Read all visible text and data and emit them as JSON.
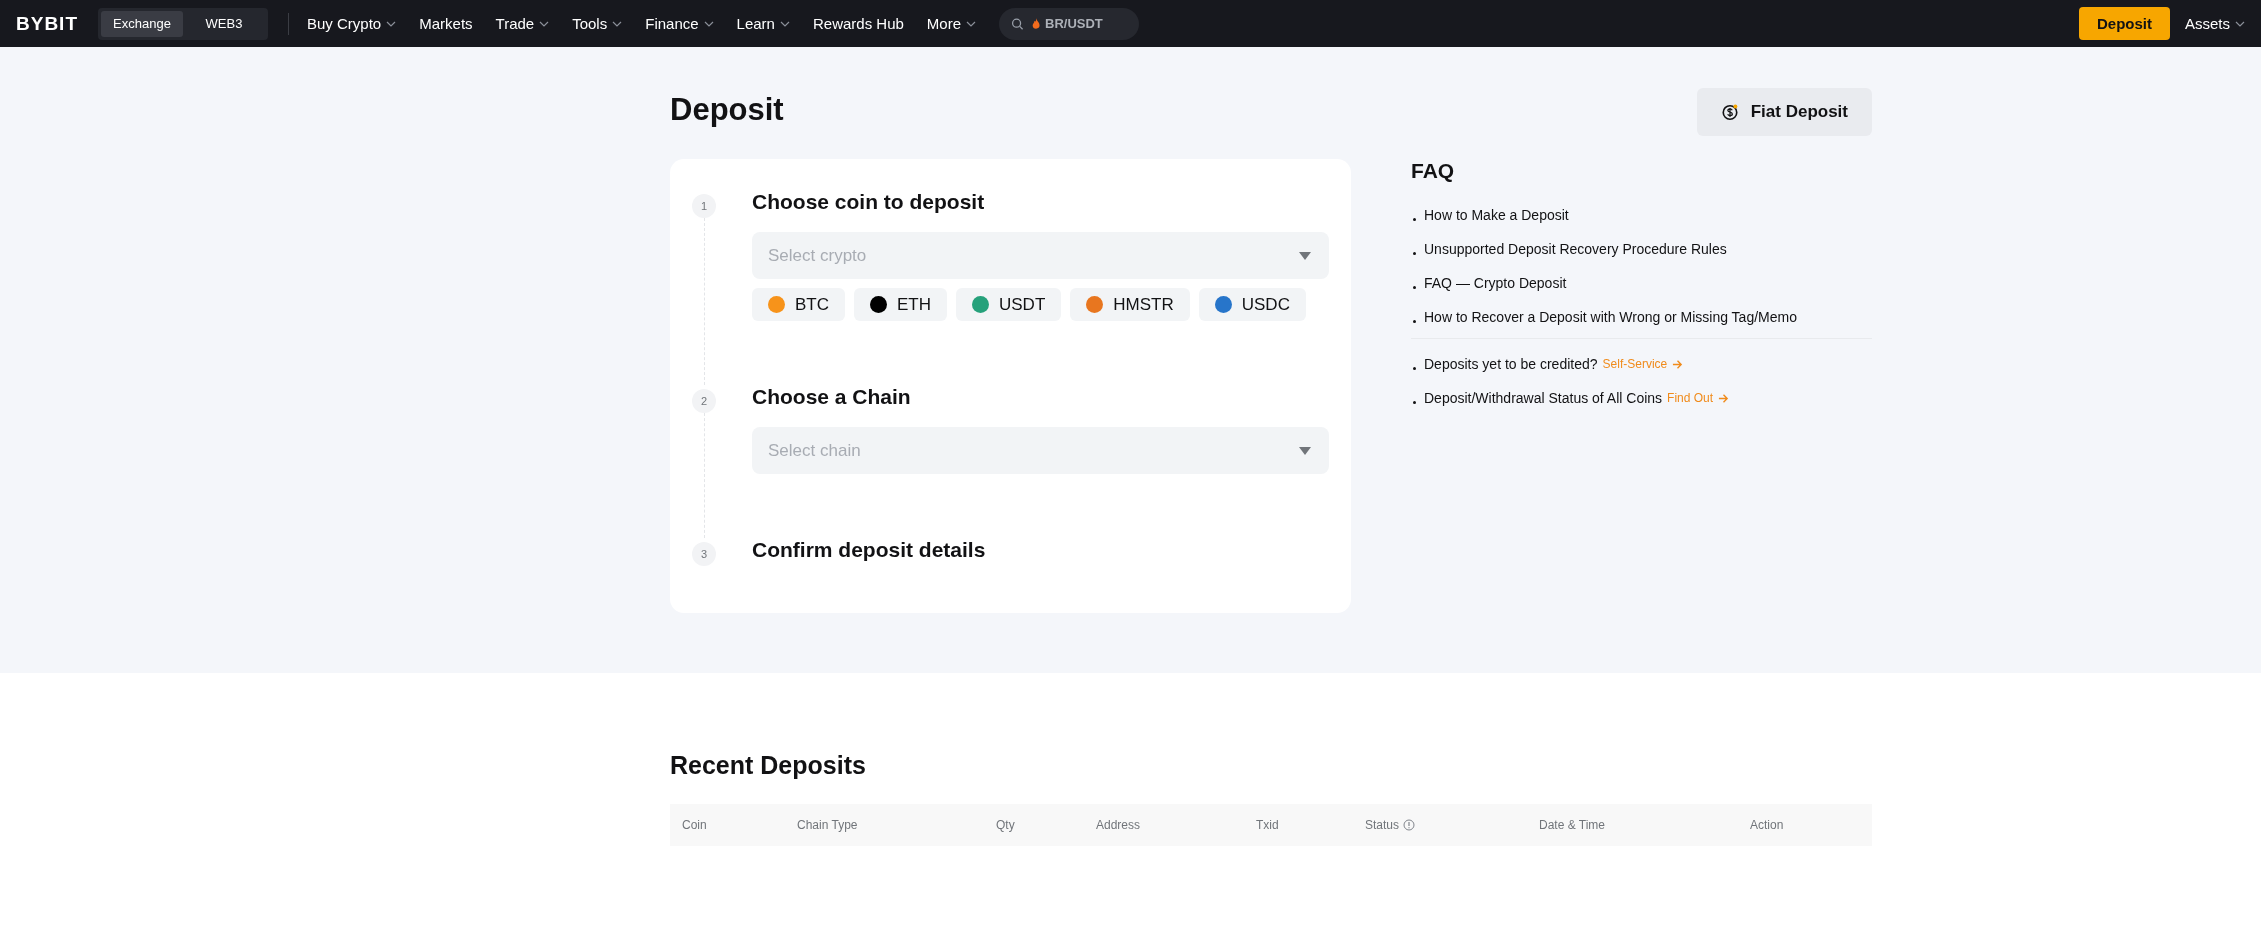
{
  "nav": {
    "logo": "BYBIT",
    "modes": [
      {
        "label": "Exchange",
        "selected": true
      },
      {
        "label": "WEB3",
        "selected": false
      }
    ],
    "menu": [
      {
        "label": "Buy Crypto",
        "dropdown": true
      },
      {
        "label": "Markets",
        "dropdown": false
      },
      {
        "label": "Trade",
        "dropdown": true
      },
      {
        "label": "Tools",
        "dropdown": true
      },
      {
        "label": "Finance",
        "dropdown": true
      },
      {
        "label": "Learn",
        "dropdown": true
      },
      {
        "label": "Rewards Hub",
        "dropdown": false
      },
      {
        "label": "More",
        "dropdown": true
      }
    ],
    "search": {
      "placeholder": "BR/USDT"
    },
    "deposit_button": "Deposit",
    "assets": {
      "label": "Assets",
      "dropdown": true
    }
  },
  "page": {
    "title": "Deposit",
    "fiat_button": "Fiat Deposit",
    "steps": [
      {
        "number": "1",
        "title": "Choose coin to deposit",
        "select": {
          "placeholder": "Select crypto"
        },
        "coins": [
          {
            "symbol": "BTC",
            "color": "#f7931a"
          },
          {
            "symbol": "ETH",
            "color": "#000000"
          },
          {
            "symbol": "USDT",
            "color": "#26a17b"
          },
          {
            "symbol": "HMSTR",
            "color": "#e8761f"
          },
          {
            "symbol": "USDC",
            "color": "#2775ca"
          }
        ]
      },
      {
        "number": "2",
        "title": "Choose a Chain",
        "select": {
          "placeholder": "Select chain"
        }
      },
      {
        "number": "3",
        "title": "Confirm deposit details"
      }
    ],
    "faq": {
      "title": "FAQ",
      "links": [
        "How to Make a Deposit",
        "Unsupported Deposit Recovery Procedure Rules",
        "FAQ — Crypto Deposit",
        "How to Recover a Deposit with Wrong or Missing Tag/Memo"
      ],
      "extras": [
        {
          "text": "Deposits yet to be credited?",
          "link": "Self-Service"
        },
        {
          "text": "Deposit/Withdrawal Status of All Coins",
          "link": "Find Out"
        }
      ]
    }
  },
  "recent": {
    "title": "Recent Deposits",
    "columns": [
      {
        "label": "Coin",
        "info": false
      },
      {
        "label": "Chain Type",
        "info": false
      },
      {
        "label": "Qty",
        "info": false
      },
      {
        "label": "Address",
        "info": false
      },
      {
        "label": "Txid",
        "info": false
      },
      {
        "label": "Status",
        "info": true
      },
      {
        "label": "Date & Time",
        "info": false
      },
      {
        "label": "Action",
        "info": false
      }
    ]
  }
}
